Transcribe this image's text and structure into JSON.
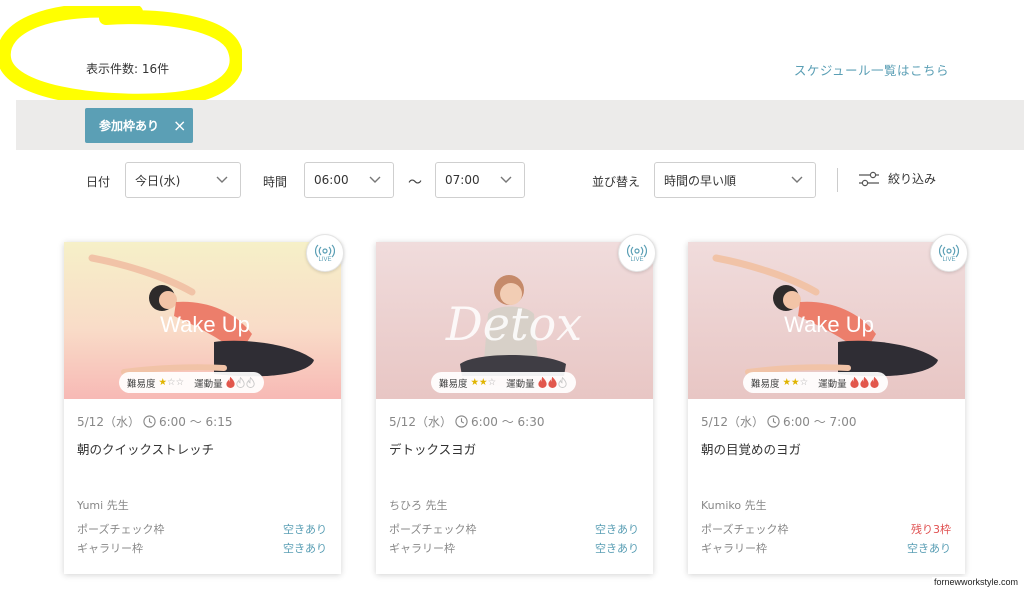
{
  "header": {
    "count_text": "表示件数: 16件",
    "schedule_link": "スケジュール一覧はこちら"
  },
  "active_filter": {
    "label": "参加枠あり",
    "remove": "×"
  },
  "filters": {
    "date_label": "日付",
    "date_value": "今日(水)",
    "time_label": "時間",
    "time_from": "06:00",
    "time_separator": "〜",
    "time_to": "07:00",
    "sort_label": "並び替え",
    "sort_value": "時間の早い順",
    "refine_label": "絞り込み"
  },
  "colors": {
    "accent": "#5b9fb5",
    "filter_band": "#ecebea",
    "warn": "#e05050",
    "star": "#e0b400",
    "flame_active": "#e2574c",
    "flame_inactive": "#c9c9c9",
    "highlight": "#ffff00"
  },
  "live_badge": {
    "text": "LIVE",
    "icon": "broadcast-icon"
  },
  "cards": [
    {
      "thumb_text": "Wake Up",
      "difficulty_label": "難易度",
      "difficulty": 1,
      "exercise_label": "運動量",
      "exercise": 1,
      "date": "5/12（水）",
      "time": "6:00 〜 6:15",
      "title": "朝のクイックストレッチ",
      "teacher": "Yumi 先生",
      "pose_label": "ポーズチェック枠",
      "pose_value": "空きあり",
      "gallery_label": "ギャラリー枠",
      "gallery_value": "空きあり"
    },
    {
      "thumb_text": "Detox",
      "difficulty_label": "難易度",
      "difficulty": 2,
      "exercise_label": "運動量",
      "exercise": 2,
      "date": "5/12（水）",
      "time": "6:00 〜 6:30",
      "title": "デトックスヨガ",
      "teacher": "ちひろ 先生",
      "pose_label": "ポーズチェック枠",
      "pose_value": "空きあり",
      "gallery_label": "ギャラリー枠",
      "gallery_value": "空きあり"
    },
    {
      "thumb_text": "Wake Up",
      "difficulty_label": "難易度",
      "difficulty": 2,
      "exercise_label": "運動量",
      "exercise": 3,
      "date": "5/12（水）",
      "time": "6:00 〜 7:00",
      "title": "朝の目覚めのヨガ",
      "teacher": "Kumiko 先生",
      "pose_label": "ポーズチェック枠",
      "pose_value": "残り3枠",
      "gallery_label": "ギャラリー枠",
      "gallery_value": "空きあり"
    }
  ],
  "watermark": "fornewworkstyle.com"
}
